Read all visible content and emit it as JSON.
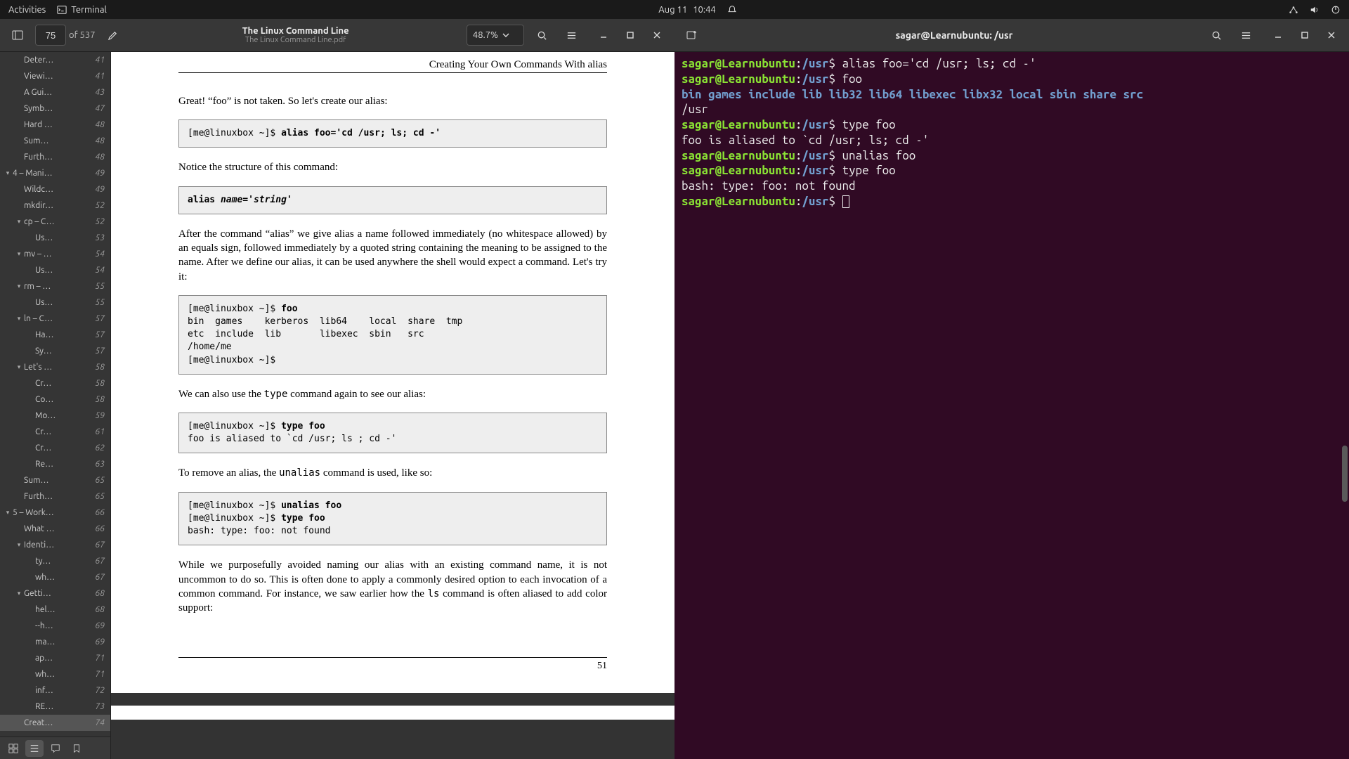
{
  "topbar": {
    "activities": "Activities",
    "terminal_label": "Terminal",
    "date": "Aug 11",
    "time": "10:44"
  },
  "pdf": {
    "page_current": "75",
    "page_total": "of 537",
    "title": "The Linux Command Line",
    "filename": "The Linux Command Line.pdf",
    "zoom": "48.7%",
    "outline": [
      {
        "indent": 2,
        "label": "Deter…",
        "page": "41",
        "expand": ""
      },
      {
        "indent": 2,
        "label": "Viewi…",
        "page": "41",
        "expand": ""
      },
      {
        "indent": 2,
        "label": "A Gui…",
        "page": "43",
        "expand": ""
      },
      {
        "indent": 2,
        "label": "Symb…",
        "page": "47",
        "expand": ""
      },
      {
        "indent": 2,
        "label": "Hard …",
        "page": "48",
        "expand": ""
      },
      {
        "indent": 2,
        "label": "Sum…",
        "page": "48",
        "expand": ""
      },
      {
        "indent": 2,
        "label": "Furth…",
        "page": "48",
        "expand": ""
      },
      {
        "indent": 1,
        "label": "4 – Mani…",
        "page": "49",
        "expand": "▾"
      },
      {
        "indent": 2,
        "label": "Wildc…",
        "page": "49",
        "expand": ""
      },
      {
        "indent": 2,
        "label": "mkdir…",
        "page": "52",
        "expand": ""
      },
      {
        "indent": 2,
        "label": "cp – C…",
        "page": "52",
        "expand": "▾"
      },
      {
        "indent": 3,
        "label": "Us…",
        "page": "53",
        "expand": ""
      },
      {
        "indent": 2,
        "label": "mv – …",
        "page": "54",
        "expand": "▾"
      },
      {
        "indent": 3,
        "label": "Us…",
        "page": "54",
        "expand": ""
      },
      {
        "indent": 2,
        "label": "rm – …",
        "page": "55",
        "expand": "▾"
      },
      {
        "indent": 3,
        "label": "Us…",
        "page": "55",
        "expand": ""
      },
      {
        "indent": 2,
        "label": "ln – C…",
        "page": "57",
        "expand": "▾"
      },
      {
        "indent": 3,
        "label": "Ha…",
        "page": "57",
        "expand": ""
      },
      {
        "indent": 3,
        "label": "Sy…",
        "page": "57",
        "expand": ""
      },
      {
        "indent": 2,
        "label": "Let's …",
        "page": "58",
        "expand": "▾"
      },
      {
        "indent": 3,
        "label": "Cr…",
        "page": "58",
        "expand": ""
      },
      {
        "indent": 3,
        "label": "Co…",
        "page": "58",
        "expand": ""
      },
      {
        "indent": 3,
        "label": "Mo…",
        "page": "59",
        "expand": ""
      },
      {
        "indent": 3,
        "label": "Cr…",
        "page": "61",
        "expand": ""
      },
      {
        "indent": 3,
        "label": "Cr…",
        "page": "62",
        "expand": ""
      },
      {
        "indent": 3,
        "label": "Re…",
        "page": "63",
        "expand": ""
      },
      {
        "indent": 2,
        "label": "Sum…",
        "page": "65",
        "expand": ""
      },
      {
        "indent": 2,
        "label": "Furth…",
        "page": "65",
        "expand": ""
      },
      {
        "indent": 1,
        "label": "5 – Work…",
        "page": "66",
        "expand": "▾"
      },
      {
        "indent": 2,
        "label": "What …",
        "page": "66",
        "expand": ""
      },
      {
        "indent": 2,
        "label": "Identi…",
        "page": "67",
        "expand": "▾"
      },
      {
        "indent": 3,
        "label": "ty…",
        "page": "67",
        "expand": ""
      },
      {
        "indent": 3,
        "label": "wh…",
        "page": "67",
        "expand": ""
      },
      {
        "indent": 2,
        "label": "Getti…",
        "page": "68",
        "expand": "▾"
      },
      {
        "indent": 3,
        "label": "hel…",
        "page": "68",
        "expand": ""
      },
      {
        "indent": 3,
        "label": "--h…",
        "page": "69",
        "expand": ""
      },
      {
        "indent": 3,
        "label": "ma…",
        "page": "69",
        "expand": ""
      },
      {
        "indent": 3,
        "label": "ap…",
        "page": "71",
        "expand": ""
      },
      {
        "indent": 3,
        "label": "wh…",
        "page": "71",
        "expand": ""
      },
      {
        "indent": 3,
        "label": "inf…",
        "page": "72",
        "expand": ""
      },
      {
        "indent": 3,
        "label": "RE…",
        "page": "73",
        "expand": ""
      },
      {
        "indent": 2,
        "label": "Creat…",
        "page": "74",
        "expand": "",
        "active": true
      }
    ],
    "content": {
      "section_title": "Creating Your Own Commands With alias",
      "p1": "Great! “foo” is not taken. So let's create our alias:",
      "code1_prompt": "[me@linuxbox ~]$ ",
      "code1_cmd": "alias foo='cd /usr; ls; cd -'",
      "p2": "Notice the structure of this command:",
      "code2_a": "alias ",
      "code2_b": "name",
      "code2_c": "='",
      "code2_d": "string",
      "code2_e": "'",
      "p3": "After the command “alias” we give alias a name followed immediately (no whitespace al­lowed) by an equals sign, followed immediately by a quoted string containing the mean­ing to be assigned to the name. After we define our alias, it can be used anywhere the shell would expect a command. Let's try it:",
      "code3_line1_prompt": "[me@linuxbox ~]$ ",
      "code3_line1_cmd": "foo",
      "code3_line2": "bin  games    kerberos  lib64    local  share  tmp",
      "code3_line3": "etc  include  lib       libexec  sbin   src",
      "code3_line4": "/home/me",
      "code3_line5": "[me@linuxbox ~]$",
      "p4a": "We can also use the ",
      "p4b": "type",
      "p4c": " command again to see our alias:",
      "code4_line1_prompt": "[me@linuxbox ~]$ ",
      "code4_line1_cmd": "type foo",
      "code4_line2": "foo is aliased to `cd /usr; ls ; cd -'",
      "p5a": "To remove an alias, the ",
      "p5b": "unalias",
      "p5c": " command is used, like so:",
      "code5_line1_prompt": "[me@linuxbox ~]$ ",
      "code5_line1_cmd": "unalias foo",
      "code5_line2_prompt": "[me@linuxbox ~]$ ",
      "code5_line2_cmd": "type foo",
      "code5_line3": "bash: type: foo: not found",
      "p6a": "While we purposefully avoided naming our alias with an existing command name, it is not uncommon to do so. This is often done to apply a commonly desired option to each invocation of a common command. For instance, we saw earlier how the ",
      "p6b": "ls",
      "p6c": " command is often aliased to add color support:",
      "page_num": "51"
    }
  },
  "terminal": {
    "title": "sagar@Learnubuntu: /usr",
    "prompt_user": "sagar@Learnubuntu",
    "prompt_colon": ":",
    "prompt_path": "/usr",
    "prompt_dollar": "$ ",
    "lines": {
      "l1_cmd": "alias foo='cd /usr; ls; cd -'",
      "l2_cmd": "foo",
      "l3_dirs": [
        "bin",
        "games",
        "include",
        "lib",
        "lib32",
        "lib64",
        "libexec",
        "libx32",
        "local",
        "sbin",
        "share",
        "src"
      ],
      "l4": "/usr",
      "l5_cmd": "type foo",
      "l6": "foo is aliased to `cd /usr; ls; cd -'",
      "l7_cmd": "unalias foo",
      "l8_cmd": "type foo",
      "l9": "bash: type: foo: not found"
    }
  }
}
